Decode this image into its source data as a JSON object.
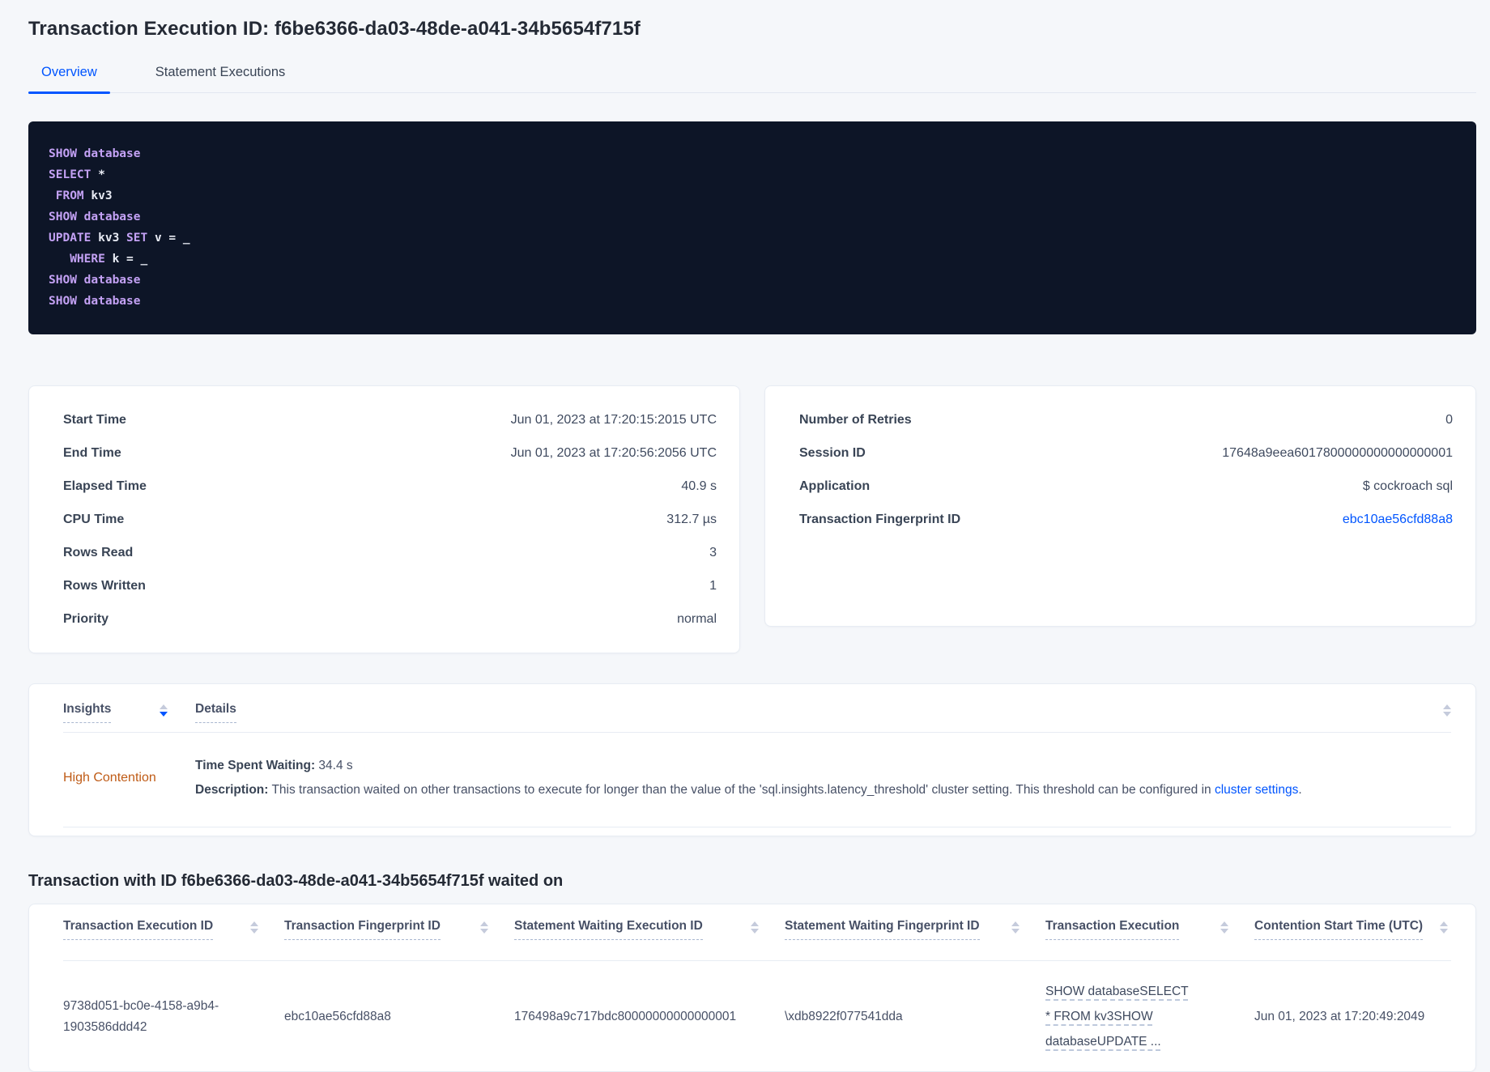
{
  "colors": {
    "accent": "#0055ff",
    "warning": "#bf5b16",
    "code-bg": "#0d1527",
    "code-text": "#e7eaf3",
    "code-keyword": "#c3a1f4"
  },
  "page": {
    "title": "Transaction Execution ID: f6be6366-da03-48de-a041-34b5654f715f"
  },
  "tabs": [
    {
      "label": "Overview"
    },
    {
      "label": "Statement Executions"
    }
  ],
  "sql_box": {
    "lines": [
      {
        "kw1": "SHOW database"
      },
      {
        "kw1": "SELECT",
        "t1": " *"
      },
      {
        "kw1": " FROM",
        "t1": " kv3"
      },
      {
        "kw1": "SHOW database"
      },
      {
        "kw1": "UPDATE",
        "t1": " kv3",
        "kw2": " SET",
        "t2": " v = _"
      },
      {
        "kw1": "   WHERE",
        "t1": " k = _"
      },
      {
        "kw1": "SHOW database"
      },
      {
        "kw1": "SHOW database"
      }
    ]
  },
  "cards": {
    "execution": {
      "rows": [
        {
          "label": "Start Time",
          "value": "Jun 01, 2023 at 17:20:15:2015 UTC"
        },
        {
          "label": "End Time",
          "value": "Jun 01, 2023 at 17:20:56:2056 UTC"
        },
        {
          "label": "Elapsed Time",
          "value": "40.9 s"
        },
        {
          "label": "CPU Time",
          "value": "312.7 µs"
        },
        {
          "label": "Rows Read",
          "value": "3"
        },
        {
          "label": "Rows Written",
          "value": "1"
        },
        {
          "label": "Priority",
          "value": "normal"
        }
      ]
    },
    "meta": {
      "rows": [
        {
          "label": "Number of Retries",
          "value": "0"
        },
        {
          "label": "Session ID",
          "value": "17648a9eea6017800000000000000001"
        },
        {
          "label": "Application",
          "value": "$ cockroach sql"
        },
        {
          "label": "Transaction Fingerprint ID",
          "value": "ebc10ae56cfd88a8"
        }
      ]
    }
  },
  "insights": {
    "columns": [
      "Insights",
      "Details"
    ],
    "row": {
      "insight": "High Contention",
      "waiting_label": "Time Spent Waiting:",
      "waiting_value": " 34.4 s",
      "description_label": "Description:",
      "description_text": " This transaction waited on other transactions to execute for longer than the value of the 'sql.insights.latency_threshold' cluster setting. This threshold can be configured in ",
      "description_link": "cluster settings",
      "description_suffix": "."
    }
  },
  "waited_on": {
    "heading": "Transaction with ID f6be6366-da03-48de-a041-34b5654f715f waited on",
    "columns": [
      "Transaction Execution ID",
      "Transaction Fingerprint ID",
      "Statement Waiting Execution ID",
      "Statement Waiting Fingerprint ID",
      "Transaction Execution",
      "Contention Start Time (UTC)"
    ],
    "row": {
      "transaction_execution_id": "9738d051-bc0e-4158-a9b4-1903586ddd42",
      "transaction_fingerprint_id": "ebc10ae56cfd88a8",
      "statement_waiting_execution_id": "176498a9c717bdc80000000000000001",
      "statement_waiting_fingerprint_id": "\\xdb8922f077541dda",
      "transaction_execution": "SHOW databaseSELECT * FROM kv3SHOW databaseUPDATE ...",
      "contention_start_time": "Jun 01, 2023 at 17:20:49:2049"
    }
  }
}
